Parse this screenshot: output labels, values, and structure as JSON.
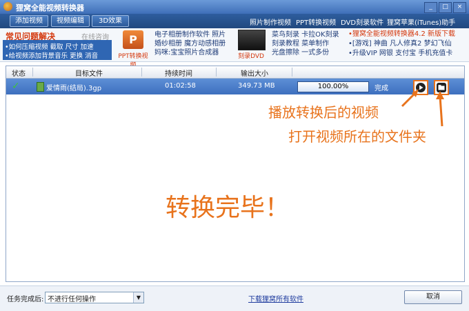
{
  "app": {
    "title": "狸窝全能视频转换器"
  },
  "toolbar": {
    "buttons": [
      "添加视频",
      "视频编辑",
      "3D效果"
    ],
    "links": [
      "照片制作视频",
      "PPT转换视频",
      "DVD刻录软件",
      "狸窝苹果(iTunes)助手"
    ]
  },
  "faq": {
    "title": "常见问题解决",
    "online": "在线咨询",
    "rows": [
      "•如何压缩视频 截取 尺寸 加速",
      "•给视频添加背景音乐 更换 消音"
    ]
  },
  "ads": {
    "ppt_caption": "PPT转换视频",
    "col1": [
      "电子相册制作软件 照片",
      "婚纱相册 魔方动感相册",
      "妈咪:宝宝照片合成器"
    ],
    "dvd_caption": "刻录DVD",
    "col2": [
      "菜鸟刻录 卡拉OK刻录",
      "刻录教程 菜单制作",
      "光盘擦除 一式多份"
    ],
    "promo": [
      "•狸窝全能视频转换器4.2 新版下载",
      "•[游戏] 神曲 凡人修真2 梦幻飞仙",
      "•升级VIP 网银 支付宝 手机充值卡"
    ]
  },
  "table": {
    "headers": [
      "状态",
      "目标文件",
      "持续时间",
      "输出大小"
    ],
    "row": {
      "file": "爱情雨(结局).3gp",
      "duration": "01:02:58",
      "size": "349.73 MB",
      "progress_text": "100.00%",
      "progress": 1.0,
      "status": "完成"
    }
  },
  "annotations": {
    "play": "播放转换后的视频",
    "folder": "打开视频所在的文件夹",
    "done": "转换完毕！"
  },
  "bottom": {
    "label": "任务完成后:",
    "select_value": "不进行任何操作",
    "link": "下载狸窝所有软件",
    "cancel": "取消"
  }
}
